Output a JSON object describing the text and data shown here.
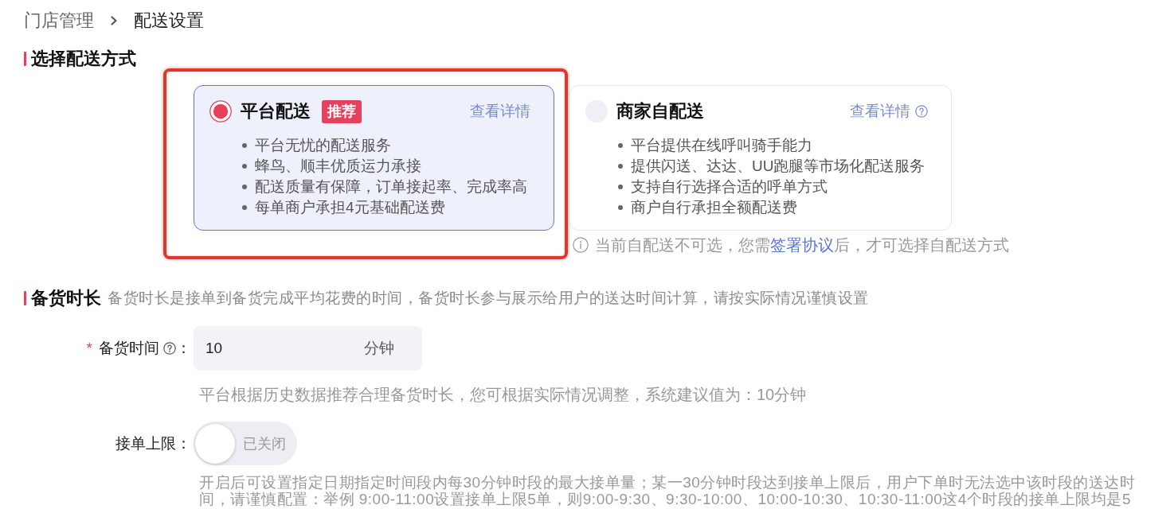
{
  "breadcrumb": [
    {
      "label": "门店管理",
      "current": false
    },
    {
      "label": "配送设置",
      "current": true
    }
  ],
  "delivery_section": {
    "title": "选择配送方式",
    "options": [
      {
        "title": "平台配送",
        "badge": "推荐",
        "selected": true,
        "disabled": false,
        "highlighted": true,
        "details_link": "查看详情",
        "details_help": false,
        "features": [
          "平台无忧的配送服务",
          "蜂鸟、顺丰优质运力承接",
          "配送质量有保障，订单接起率、完成率高",
          "每单商户承担4元基础配送费"
        ]
      },
      {
        "title": "商家自配送",
        "selected": false,
        "disabled": true,
        "highlighted": false,
        "details_link": "查看详情",
        "details_help": true,
        "features": [
          "平台提供在线呼叫骑手能力",
          "提供闪送、达达、UU跑腿等市场化配送服务",
          "支持自行选择合适的呼单方式",
          "商户自行承担全额配送费"
        ],
        "notice": {
          "before": "当前自配送不可选，您需",
          "link": "签署协议",
          "after": "后，才可选择自配送方式"
        }
      }
    ]
  },
  "prep_section": {
    "title": "备货时长",
    "description": "备货时长是接单到备货完成平均花费的时间，备货时长参与展示给用户的送达时间计算，请按实际情况谨慎设置",
    "rows": [
      {
        "kind": "input",
        "required_mark": "*",
        "label": "备货时间",
        "help": true,
        "separator": "：",
        "value": "10",
        "suffix": "分钟",
        "hint": "平台根据历史数据推荐合理备货时长，您可根据实际情况调整，系统建议值为：10分钟"
      },
      {
        "kind": "toggle",
        "label": "接单上限",
        "help": false,
        "separator": "：",
        "on": false,
        "state_text": "已关闭",
        "hint": "开启后可设置指定日期指定时间段内每30分钟时段的最大接单量；某一30分钟时段达到接单上限后，用户下单时无法选中该时段的送达时间，请谨慎配置：举例 9:00-11:00设置接单上限5单，则9:00-9:30、9:30-10:00、10:00-10:30、10:30-11:00这4个时段的接单上限均是5"
      }
    ]
  }
}
